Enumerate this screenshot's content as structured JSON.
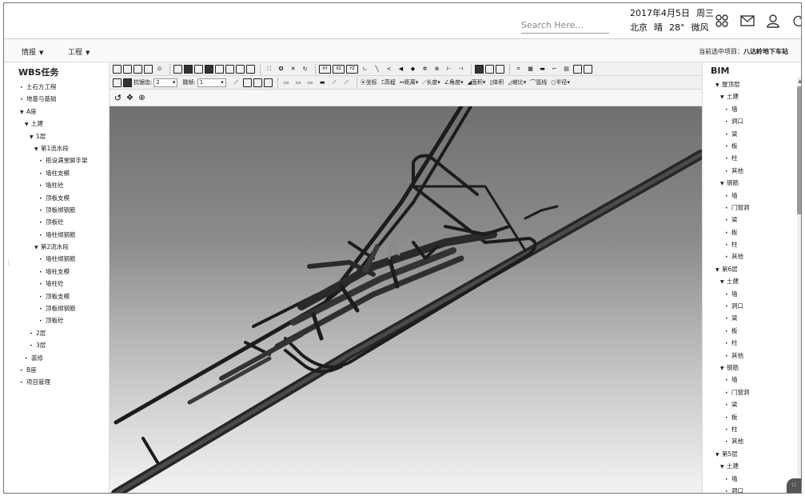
{
  "header": {
    "search_placeholder": "Search Here...",
    "date": "2017年4月5日",
    "weekday": "周三",
    "city": "北京",
    "weather": "晴",
    "temperature": "28°",
    "wind": "微风",
    "icons": [
      "apps-icon",
      "mail-icon",
      "user-icon",
      "refresh-icon"
    ]
  },
  "menubar": {
    "menus": [
      "情报",
      "工程"
    ],
    "current_project_label": "当前选中项目：",
    "current_project": "八达岭地下车站"
  },
  "left_panel": {
    "title": "WBS任务",
    "items": [
      {
        "level": 0,
        "marker": "•",
        "label": "土石方工程"
      },
      {
        "level": 0,
        "marker": "•",
        "label": "地基与基础"
      },
      {
        "level": 0,
        "marker": "▼",
        "label": "A座"
      },
      {
        "level": 1,
        "marker": "▼",
        "label": "土建"
      },
      {
        "level": 2,
        "marker": "▼",
        "label": "1层"
      },
      {
        "level": 3,
        "marker": "▼",
        "label": "第1流水段"
      },
      {
        "level": 4,
        "marker": "•",
        "label": "搭设满堂脚手架"
      },
      {
        "level": 4,
        "marker": "•",
        "label": "墙柱支模"
      },
      {
        "level": 4,
        "marker": "•",
        "label": "墙柱砼"
      },
      {
        "level": 4,
        "marker": "•",
        "label": "顶板支模"
      },
      {
        "level": 4,
        "marker": "•",
        "label": "顶板绑钢筋"
      },
      {
        "level": 4,
        "marker": "•",
        "label": "顶板砼"
      },
      {
        "level": 4,
        "marker": "•",
        "label": "墙柱绑钢筋"
      },
      {
        "level": 3,
        "marker": "▼",
        "label": "第2流水段"
      },
      {
        "level": 4,
        "marker": "•",
        "label": "墙柱绑钢筋"
      },
      {
        "level": 4,
        "marker": "•",
        "label": "墙柱支模"
      },
      {
        "level": 4,
        "marker": "•",
        "label": "墙柱砼"
      },
      {
        "level": 4,
        "marker": "•",
        "label": "顶板支模"
      },
      {
        "level": 4,
        "marker": "•",
        "label": "顶板绑钢筋"
      },
      {
        "level": 4,
        "marker": "•",
        "label": "顶板砼"
      },
      {
        "level": 2,
        "marker": "•",
        "label": "2层"
      },
      {
        "level": 2,
        "marker": "•",
        "label": "3层"
      },
      {
        "level": 1,
        "marker": "•",
        "label": "装修"
      },
      {
        "level": 0,
        "marker": "•",
        "label": "B座"
      },
      {
        "level": 0,
        "marker": "•",
        "label": "项目管理"
      }
    ]
  },
  "toolbar": {
    "row1_icons": [
      "new-icon",
      "open-icon",
      "save-icon",
      "export-icon",
      "settings-icon",
      "view-front-icon",
      "view-back-icon",
      "view-left-icon",
      "view-right-icon",
      "view-top-icon",
      "view-bottom-icon",
      "view-iso-icon",
      "fit-icon",
      "orbit-icon",
      "hide-icon",
      "rotate-icon",
      "plane-xy-icon",
      "plane-xz-icon",
      "plane-yz-icon",
      "axis-icon",
      "line-icon",
      "node-icon",
      "wall-icon",
      "point-icon",
      "gear-small-icon",
      "circle-icon",
      "dimension-icon",
      "measure-icon",
      "solid-icon",
      "wire-icon",
      "hidden-line-icon",
      "frame-icon",
      "transparent-icon",
      "shade-icon",
      "edge-icon",
      "texture-icon",
      "zoom-window-icon"
    ],
    "row1_text_icons": {
      "xy": "XY",
      "xz": "XZ",
      "yz": "YZ"
    },
    "shrink_label": "抗锯齿:",
    "shrink_value": "2",
    "skip_label": "跳帧:",
    "skip_value": "1",
    "measure_tools": [
      "坐标",
      "高程",
      "距离",
      "长度",
      "角度",
      "面积",
      "体积",
      "坡比",
      "弧线",
      "半径"
    ],
    "row3_icons": [
      "undo-rotate-icon",
      "pan-icon",
      "zoom-icon"
    ]
  },
  "right_panel": {
    "title": "BIM",
    "items": [
      {
        "level": 0,
        "marker": "▼",
        "label": "屋顶层"
      },
      {
        "level": 1,
        "marker": "▼",
        "label": "土建"
      },
      {
        "level": 2,
        "marker": "•",
        "label": "墙"
      },
      {
        "level": 2,
        "marker": "•",
        "label": "洞口"
      },
      {
        "level": 2,
        "marker": "•",
        "label": "梁"
      },
      {
        "level": 2,
        "marker": "•",
        "label": "板"
      },
      {
        "level": 2,
        "marker": "•",
        "label": "柱"
      },
      {
        "level": 2,
        "marker": "•",
        "label": "其他"
      },
      {
        "level": 1,
        "marker": "▼",
        "label": "钢筋"
      },
      {
        "level": 2,
        "marker": "•",
        "label": "墙"
      },
      {
        "level": 2,
        "marker": "•",
        "label": "门窗洞"
      },
      {
        "level": 2,
        "marker": "•",
        "label": "梁"
      },
      {
        "level": 2,
        "marker": "•",
        "label": "板"
      },
      {
        "level": 2,
        "marker": "•",
        "label": "柱"
      },
      {
        "level": 2,
        "marker": "•",
        "label": "其他"
      },
      {
        "level": 0,
        "marker": "▼",
        "label": "第6层"
      },
      {
        "level": 1,
        "marker": "▼",
        "label": "土建"
      },
      {
        "level": 2,
        "marker": "•",
        "label": "墙"
      },
      {
        "level": 2,
        "marker": "•",
        "label": "洞口"
      },
      {
        "level": 2,
        "marker": "•",
        "label": "梁"
      },
      {
        "level": 2,
        "marker": "•",
        "label": "板"
      },
      {
        "level": 2,
        "marker": "•",
        "label": "柱"
      },
      {
        "level": 2,
        "marker": "•",
        "label": "其他"
      },
      {
        "level": 1,
        "marker": "▼",
        "label": "钢筋"
      },
      {
        "level": 2,
        "marker": "•",
        "label": "墙"
      },
      {
        "level": 2,
        "marker": "•",
        "label": "门窗洞"
      },
      {
        "level": 2,
        "marker": "•",
        "label": "梁"
      },
      {
        "level": 2,
        "marker": "•",
        "label": "板"
      },
      {
        "level": 2,
        "marker": "•",
        "label": "柱"
      },
      {
        "level": 2,
        "marker": "•",
        "label": "其他"
      },
      {
        "level": 0,
        "marker": "▼",
        "label": "第5层"
      },
      {
        "level": 1,
        "marker": "▼",
        "label": "土建"
      },
      {
        "level": 2,
        "marker": "•",
        "label": "墙"
      },
      {
        "level": 2,
        "marker": "•",
        "label": "洞口"
      },
      {
        "level": 2,
        "marker": "•",
        "label": "梁"
      }
    ]
  }
}
